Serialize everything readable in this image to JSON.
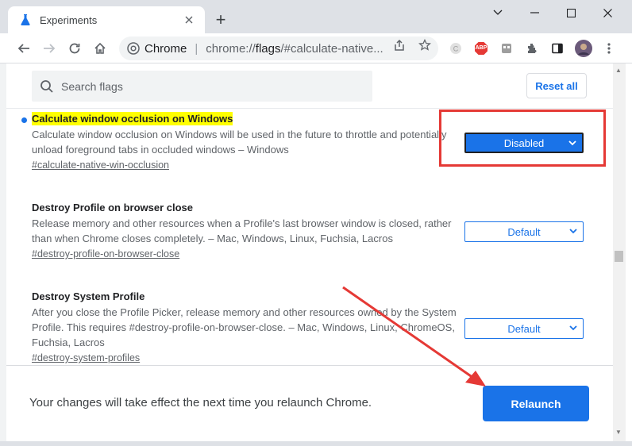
{
  "tab": {
    "title": "Experiments",
    "new_tab_label": "+"
  },
  "omnibox": {
    "site_label": "Chrome",
    "separator": "|",
    "url_prefix": "chrome://",
    "url_bold": "flags",
    "url_rest": "/#calculate-native..."
  },
  "toolbar": {
    "extensions": [
      "c-extension-icon",
      "abp-icon",
      "media-router-icon",
      "puzzle-icon",
      "side-panel-icon",
      "avatar",
      "kebab-menu-icon"
    ],
    "abp_label": "ABP"
  },
  "search": {
    "placeholder": "Search flags"
  },
  "reset_button": "Reset all",
  "flags": [
    {
      "name": "Calculate window occlusion on Windows",
      "description": "Calculate window occlusion on Windows will be used in the future to throttle and potentially unload foreground tabs in occluded windows – Windows",
      "link": "#calculate-native-win-occlusion",
      "value": "Disabled",
      "highlighted": true
    },
    {
      "name": "Destroy Profile on browser close",
      "description": "Release memory and other resources when a Profile's last browser window is closed, rather than when Chrome closes completely. – Mac, Windows, Linux, Fuchsia, Lacros",
      "link": "#destroy-profile-on-browser-close",
      "value": "Default",
      "highlighted": false
    },
    {
      "name": "Destroy System Profile",
      "description": "After you close the Profile Picker, release memory and other resources owned by the System Profile. This requires #destroy-profile-on-browser-close. – Mac, Windows, Linux, ChromeOS, Fuchsia, Lacros",
      "link": "#destroy-system-profiles",
      "value": "Default",
      "highlighted": false
    }
  ],
  "footer": {
    "message": "Your changes will take effect the next time you relaunch Chrome.",
    "relaunch_label": "Relaunch"
  },
  "colors": {
    "accent": "#1a73e8",
    "highlight": "#ffff00",
    "annotation_red": "#e53935"
  }
}
